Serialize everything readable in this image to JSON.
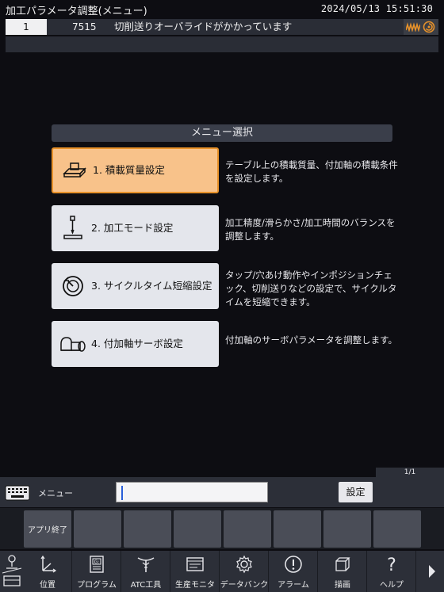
{
  "header": {
    "title": "加工パラメータ調整(メニュー)",
    "datetime": "2024/05/13 15:51:30"
  },
  "message": {
    "index": "1",
    "code": "7515",
    "text": "切削送りオーバライドがかかっています",
    "icons": [
      "wave-icon",
      "swirl-icon"
    ],
    "icon_color": "#e8922a"
  },
  "menu": {
    "header": "メニュー選択",
    "items": [
      {
        "label": "1. 積載質量設定",
        "description": "テーブル上の積載質量、付加軸の積載条件を設定します。",
        "icon": "table-load-icon",
        "active": true
      },
      {
        "label": "2. 加工モード設定",
        "description": "加工精度/滑らかさ/加工時間のバランスを調整します。",
        "icon": "tool-mode-icon",
        "active": false
      },
      {
        "label": "3. サイクルタイム短縮設定",
        "description": "タップ/穴あけ動作やインポジションチェック、切削送りなどの設定で、サイクルタイムを短縮できます。",
        "icon": "cycle-time-icon",
        "active": false
      },
      {
        "label": "4. 付加軸サーボ設定",
        "description": "付加軸のサーボパラメータを調整します。",
        "icon": "rotary-axis-icon",
        "active": false
      }
    ]
  },
  "input": {
    "label": "メニュー",
    "value": "",
    "set_label": "設定",
    "page": "1/1"
  },
  "fkeys": [
    "アプリ終了",
    "",
    "",
    "",
    "",
    "",
    "",
    "",
    ""
  ],
  "apps": [
    {
      "label": "位置",
      "icon": "position-axes-icon"
    },
    {
      "label": "プログラム",
      "icon": "program-icon"
    },
    {
      "label": "ATC工具",
      "icon": "atc-tool-icon"
    },
    {
      "label": "生産モニタ",
      "icon": "production-monitor-icon"
    },
    {
      "label": "データバンク",
      "icon": "data-bank-gear-icon"
    },
    {
      "label": "アラーム",
      "icon": "alarm-icon"
    },
    {
      "label": "描画",
      "icon": "drawing-cube-icon"
    },
    {
      "label": "ヘルプ",
      "icon": "help-icon"
    }
  ]
}
